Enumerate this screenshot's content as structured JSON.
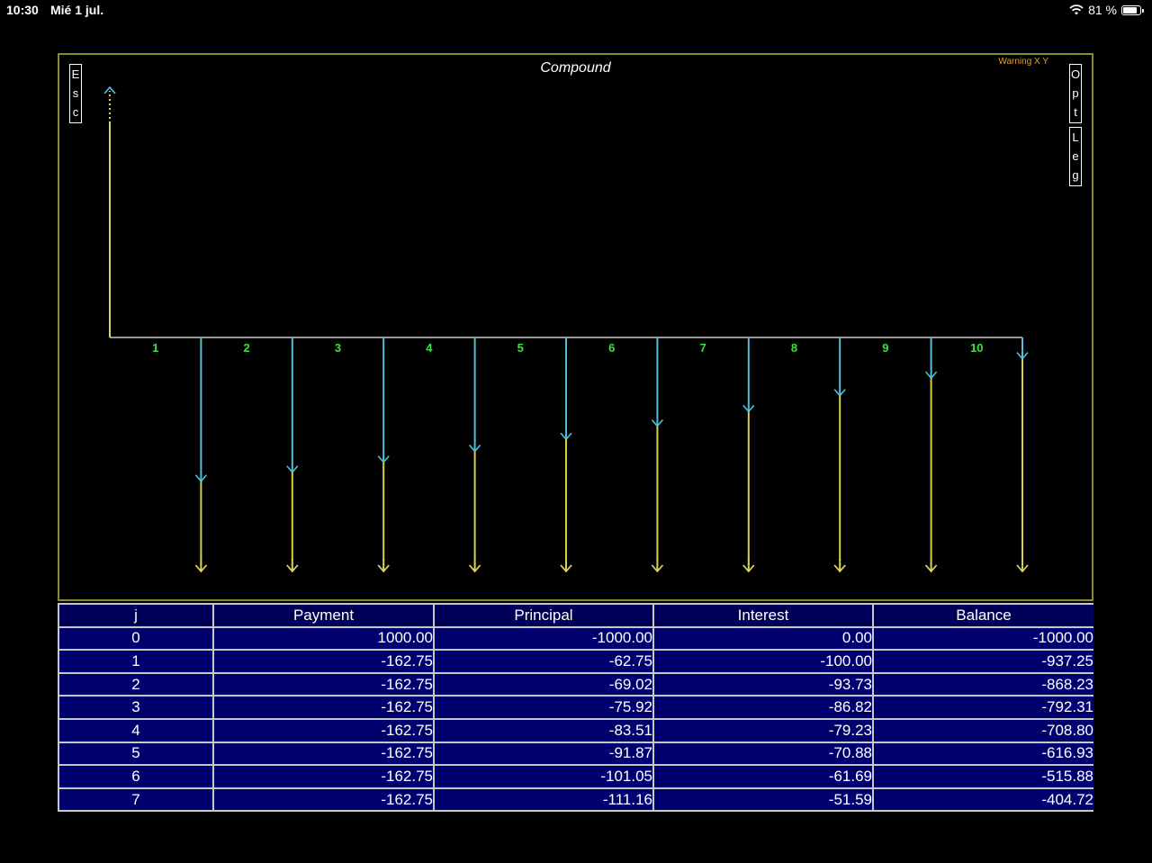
{
  "status_bar": {
    "time": "10:30",
    "date": "Mié 1 jul.",
    "battery": "81 %",
    "battery_level": 0.81
  },
  "chart": {
    "title": "Compound",
    "warning": "Warning X Y",
    "esc_label": [
      "E",
      "s",
      "c"
    ],
    "opt_label": [
      "O",
      "p",
      "t"
    ],
    "leg_label": [
      "L",
      "e",
      "g"
    ],
    "colors": {
      "axis": "#c8c8c8",
      "payment": "#d8d060",
      "principal": "#d8d040",
      "interest": "#50c0d8",
      "balance": "#909090",
      "period_label": "#40e040",
      "frame": "#8a8a2a"
    }
  },
  "chart_data": {
    "type": "cash-flow",
    "title": "Compound",
    "periods": [
      "1",
      "2",
      "3",
      "4",
      "5",
      "6",
      "7",
      "8",
      "9",
      "10"
    ],
    "x": [
      0,
      1,
      2,
      3,
      4,
      5,
      6,
      7,
      8,
      9,
      10
    ],
    "payment": [
      1000.0,
      -162.75,
      -162.75,
      -162.75,
      -162.75,
      -162.75,
      -162.75,
      -162.75,
      -162.75,
      -162.75,
      -162.75
    ],
    "principal": [
      -1000.0,
      -62.75,
      -69.02,
      -75.92,
      -83.51,
      -91.87,
      -101.05,
      -111.16,
      -122.27,
      -134.5,
      -147.95
    ],
    "interest": [
      0.0,
      -100.0,
      -93.73,
      -86.82,
      -79.23,
      -70.88,
      -61.69,
      -51.59,
      -40.47,
      -28.25,
      -14.8
    ]
  },
  "table": {
    "headers": [
      "j",
      "Payment",
      "Principal",
      "Interest",
      "Balance"
    ],
    "rows": [
      [
        "0",
        "1000.00",
        "-1000.00",
        "0.00",
        "-1000.00"
      ],
      [
        "1",
        "-162.75",
        "-62.75",
        "-100.00",
        "-937.25"
      ],
      [
        "2",
        "-162.75",
        "-69.02",
        "-93.73",
        "-868.23"
      ],
      [
        "3",
        "-162.75",
        "-75.92",
        "-86.82",
        "-792.31"
      ],
      [
        "4",
        "-162.75",
        "-83.51",
        "-79.23",
        "-708.80"
      ],
      [
        "5",
        "-162.75",
        "-91.87",
        "-70.88",
        "-616.93"
      ],
      [
        "6",
        "-162.75",
        "-101.05",
        "-61.69",
        "-515.88"
      ],
      [
        "7",
        "-162.75",
        "-111.16",
        "-51.59",
        "-404.72"
      ]
    ]
  }
}
